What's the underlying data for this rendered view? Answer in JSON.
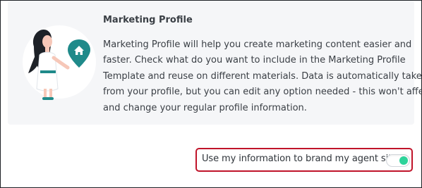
{
  "card": {
    "title": "Marketing Profile",
    "body_lines": [
      "Marketing Profile will help you create marketing content easier and",
      "faster. Check what do you want to include in the Marketing Profile",
      "Template and reuse on different materials. Data is automatically taken",
      "from your profile, but you can edit any option needed - this won't affect",
      "and change your regular profile information."
    ]
  },
  "toggle": {
    "label": "Use my information to brand my agent site",
    "state": "on"
  },
  "colors": {
    "card_background": "#f5f6f8",
    "highlight_border": "#c0142a",
    "toggle_accent": "#2ed39a",
    "illustration_teal": "#1f8a8a"
  }
}
